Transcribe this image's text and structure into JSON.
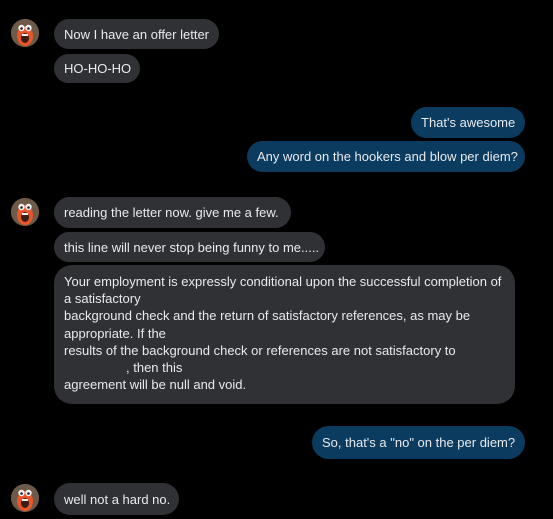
{
  "colors": {
    "background": "#000000",
    "incoming_bubble": "#303134",
    "outgoing_bubble": "#0b3b5f",
    "text": "#e8eaed"
  },
  "messages": [
    {
      "sender": "contact",
      "text": "Now I have an offer letter"
    },
    {
      "sender": "contact",
      "text": "HO-HO-HO"
    },
    {
      "sender": "me",
      "text": "That's awesome"
    },
    {
      "sender": "me",
      "text": "Any word on the hookers and blow per diem?"
    },
    {
      "sender": "contact",
      "text": "reading the letter now.  give me a few."
    },
    {
      "sender": "contact",
      "text": "this line will never stop being funny to me....."
    },
    {
      "sender": "contact",
      "lines": [
        "Your employment is expressly conditional upon the successful completion of",
        "a satisfactory",
        "background check and the return of satisfactory references, as may be",
        "appropriate. If the",
        "results of the background check or references are not satisfactory to",
        ", then this",
        "agreement will be null and void."
      ]
    },
    {
      "sender": "me",
      "text": "So, that's a \"no\" on the per diem?"
    },
    {
      "sender": "contact",
      "text": "well not a hard no."
    }
  ],
  "avatar_icon": "contact-avatar-icon"
}
